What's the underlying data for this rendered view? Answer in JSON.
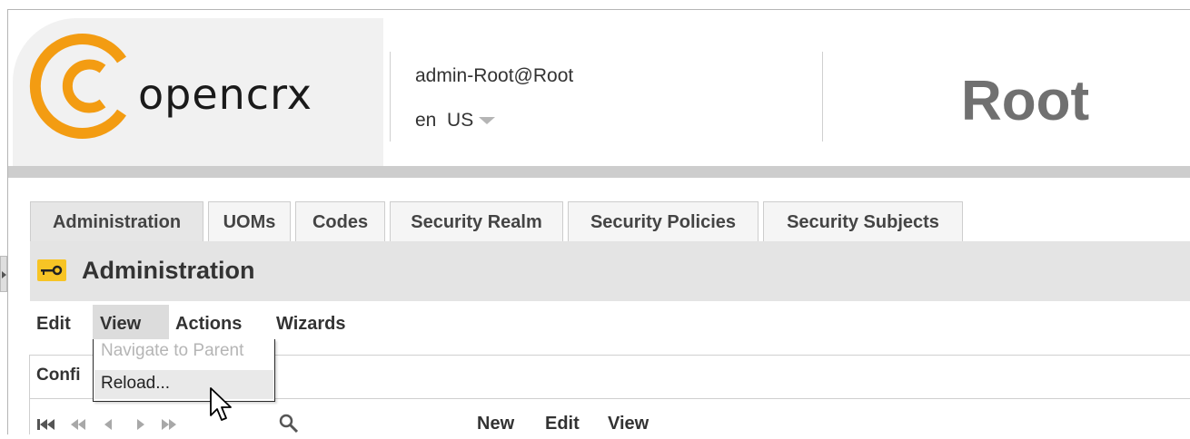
{
  "header": {
    "logo_text": "opencrx",
    "user": "admin-Root@Root",
    "locale": "en  US",
    "segment": "Root"
  },
  "tabs": [
    {
      "label": "Administration",
      "active": true
    },
    {
      "label": "UOMs"
    },
    {
      "label": "Codes"
    },
    {
      "label": "Security Realm"
    },
    {
      "label": "Security Policies"
    },
    {
      "label": "Security Subjects"
    }
  ],
  "page_title": "Administration",
  "menubar": {
    "edit": "Edit",
    "view": "View",
    "actions": "Actions",
    "wizards": "Wizards"
  },
  "view_menu": {
    "navigate_parent": "Navigate to Parent",
    "reload": "Reload..."
  },
  "panel": {
    "tab_label": "Confi",
    "toolbar": {
      "new": "New",
      "edit": "Edit",
      "view": "View"
    }
  },
  "colors": {
    "logo_orange": "#f39c12",
    "key_icon_yellow": "#f7c425",
    "segment_title": "#707070"
  }
}
